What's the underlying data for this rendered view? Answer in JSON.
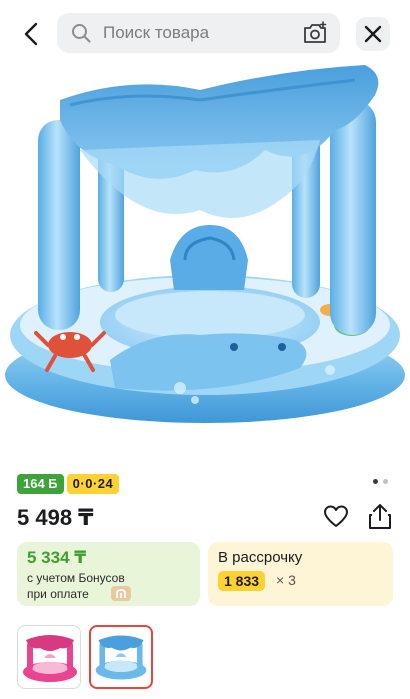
{
  "search": {
    "placeholder": "Поиск товара"
  },
  "icons": {
    "back": "chevron-left-icon",
    "search": "search-icon",
    "camera": "camera-search-icon",
    "close": "close-icon",
    "favorite": "heart-icon",
    "share": "share-icon",
    "kaspi": "kaspi-logo-icon"
  },
  "product": {
    "image_alt": "Надувной круг с навесом голубой",
    "bonus_badge": "164 Б",
    "installment_badge": "0·0·24",
    "price": "5 498 ₸",
    "gallery_total_dots": 2,
    "gallery_active_dot": 1
  },
  "bonus_card": {
    "price": "5 334 ₸",
    "line1": "с учетом Бонусов",
    "line2": "при оплате"
  },
  "installment_card": {
    "title": "В рассрочку",
    "amount": "1 833",
    "times": "× 3"
  },
  "thumbnails": [
    {
      "color": "pink",
      "selected": false
    },
    {
      "color": "blue",
      "selected": true
    }
  ],
  "colors": {
    "accent_green": "#3fa33a",
    "accent_yellow": "#ffd233",
    "selection_red": "#e5463b",
    "pool_blue": "#7fc4ee"
  }
}
